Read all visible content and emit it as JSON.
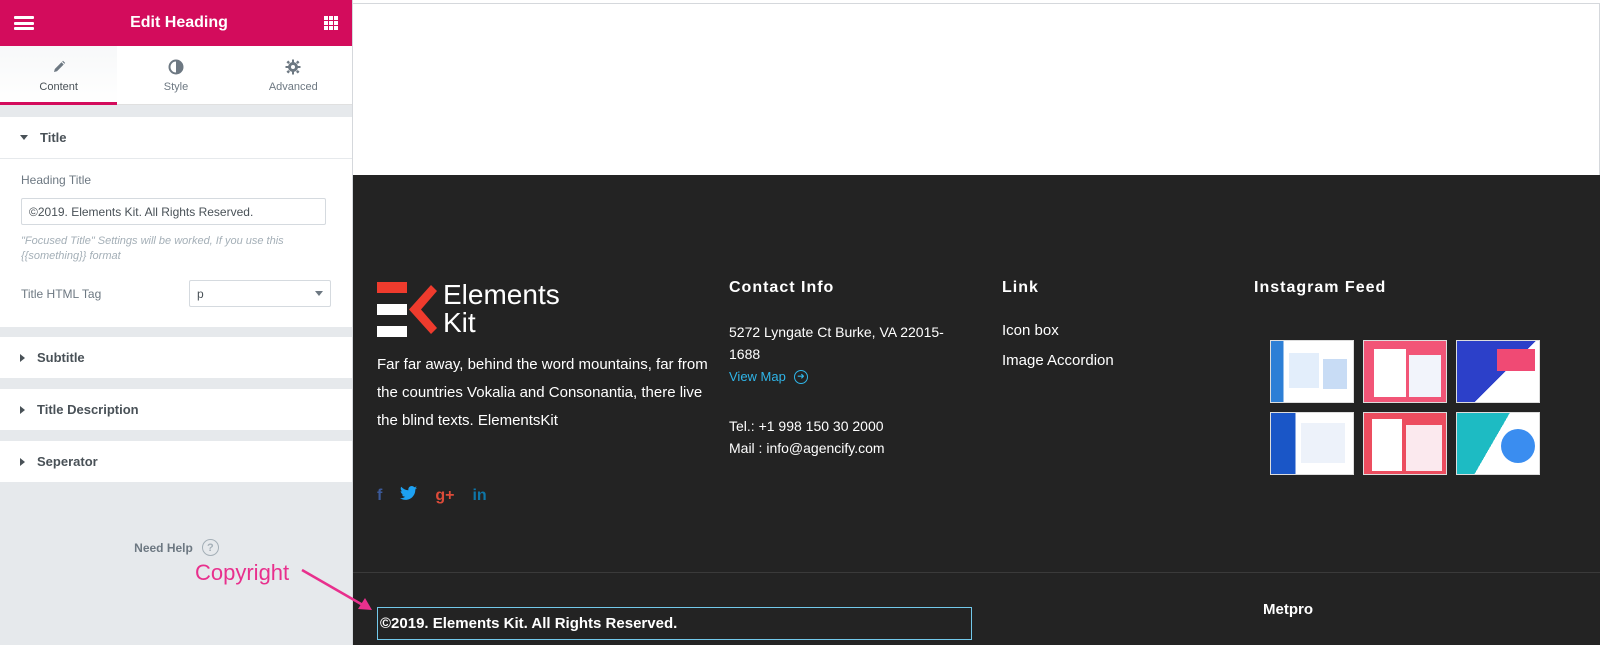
{
  "panel": {
    "title": "Edit Heading",
    "tabs": [
      {
        "label": "Content",
        "active": true
      },
      {
        "label": "Style",
        "active": false
      },
      {
        "label": "Advanced",
        "active": false
      }
    ],
    "sections": {
      "title": "Title",
      "subtitle": "Subtitle",
      "title_description": "Title Description",
      "separator": "Seperator"
    },
    "heading_title_label": "Heading Title",
    "heading_title_value": "©2019. Elements Kit. All Rights Reserved.",
    "hint": "\"Focused Title\" Settings will be worked, If you use this {{something}} format",
    "html_tag_label": "Title HTML Tag",
    "html_tag_value": "p",
    "need_help": "Need Help",
    "accent_color": "#d30c5c"
  },
  "footer": {
    "logo_line1": "Elements",
    "logo_line2": "Kit",
    "about_text": "Far far away, behind the word mountains, far from the countries Vokalia and Consonantia, there live the blind texts. ElementsKit",
    "contact_title": "Contact Info",
    "address": "5272 Lyngate Ct Burke, VA 22015-1688",
    "view_map": "View Map",
    "tel": "Tel.: +1 998 150 30 2000",
    "mail": "Mail : info@agencify.com",
    "link_title": "Link",
    "links": [
      "Icon box",
      "Image Accordion"
    ],
    "instagram_title": "Instagram Feed",
    "copyright": "©2019. Elements Kit. All Rights Reserved.",
    "metpro": "Metpro",
    "background": "#232323"
  },
  "annotation": {
    "label": "Copyright",
    "color": "#e8308d"
  }
}
